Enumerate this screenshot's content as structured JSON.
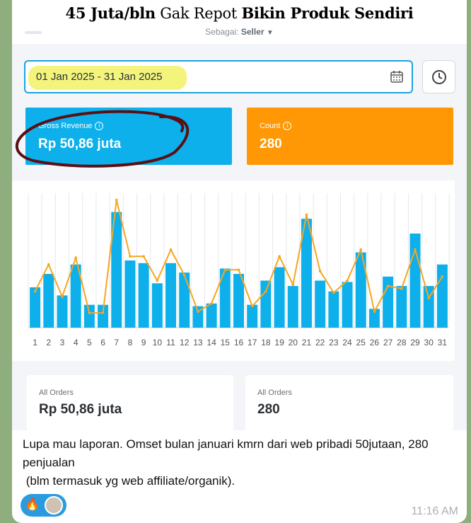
{
  "headline": {
    "bold1": "45 Juta/bln",
    "normal": "Gak Repot",
    "bold2": "Bikin Produk Sendiri"
  },
  "role": {
    "label": "Sebagai:",
    "value": "Seller"
  },
  "date_range": "01 Jan 2025 - 31 Jan 2025",
  "cards": {
    "revenue": {
      "label": "Gross Revenue",
      "value": "Rp 50,86 juta",
      "color": "#0db0ea"
    },
    "count": {
      "label": "Count",
      "value": "280",
      "color": "#ff9804"
    }
  },
  "chart_data": {
    "type": "bar",
    "categories": [
      "1",
      "2",
      "3",
      "4",
      "5",
      "6",
      "7",
      "8",
      "9",
      "10",
      "11",
      "12",
      "13",
      "14",
      "15",
      "16",
      "17",
      "18",
      "19",
      "20",
      "21",
      "22",
      "23",
      "24",
      "25",
      "26",
      "27",
      "28",
      "29",
      "30",
      "31"
    ],
    "series": [
      {
        "type": "bar",
        "color": "#0db0ea",
        "values": [
          30,
          40,
          24,
          47,
          17,
          17,
          86,
          50,
          48,
          33,
          48,
          41,
          16,
          18,
          44,
          40,
          17,
          35,
          45,
          31,
          81,
          35,
          27,
          34,
          56,
          14,
          38,
          31,
          70,
          31,
          47
        ]
      },
      {
        "type": "line",
        "color": "#f7a520",
        "values": [
          27,
          47,
          23,
          52,
          11,
          11,
          95,
          53,
          53,
          35,
          58,
          39,
          12,
          18,
          43,
          43,
          16,
          27,
          53,
          32,
          84,
          42,
          26,
          35,
          58,
          12,
          31,
          29,
          58,
          22,
          38
        ]
      }
    ],
    "ylim": [
      0,
      100
    ]
  },
  "bottom": {
    "all_orders_revenue": {
      "label": "All Orders",
      "value": "Rp 50,86 juta"
    },
    "all_orders_count": {
      "label": "All Orders",
      "value": "280"
    }
  },
  "message": {
    "text": "Lupa mau laporan. Omset bulan januari kmrn dari web pribadi 50jutaan, 280 penjualan\n (blm termasuk yg web affiliate/organik).",
    "time": "11:16 AM",
    "reaction_emoji": "🔥"
  }
}
